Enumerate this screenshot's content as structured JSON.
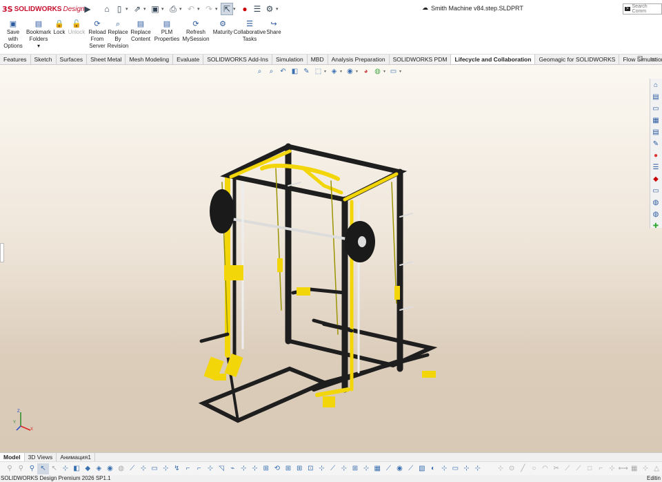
{
  "app": {
    "brand": "SOLIDWORKS",
    "brand_suffix": "Design",
    "logo_mark": "3S"
  },
  "document": {
    "title": "Smith Machine v84.step.SLDPRT"
  },
  "search": {
    "placeholder": "Search Comm"
  },
  "quick_access": [
    "home-icon",
    "new-icon",
    "open-icon",
    "save-icon",
    "print-icon",
    "undo-icon",
    "redo-icon",
    "select-icon",
    "traffic-light-icon",
    "file-properties-icon",
    "options-icon"
  ],
  "ribbon": {
    "buttons": [
      {
        "label": "Save with Options",
        "lines": [
          "Save",
          "with",
          "Options"
        ],
        "icon": "save-options-icon",
        "disabled": false
      },
      {
        "label": "Bookmark Folders",
        "lines": [
          "Bookmark",
          "Folders",
          "▾"
        ],
        "icon": "bookmark-icon",
        "disabled": false
      },
      {
        "label": "Lock",
        "lines": [
          "Lock"
        ],
        "icon": "lock-icon",
        "disabled": false
      },
      {
        "label": "Unlock",
        "lines": [
          "Unlock"
        ],
        "icon": "unlock-icon",
        "disabled": true
      },
      {
        "label": "Reload From Server",
        "lines": [
          "Reload",
          "From",
          "Server"
        ],
        "icon": "reload-icon",
        "disabled": false
      },
      {
        "label": "Replace By Revision",
        "lines": [
          "Replace",
          "By",
          "Revision"
        ],
        "icon": "replace-revision-icon",
        "disabled": false
      },
      {
        "label": "Replace Content",
        "lines": [
          "Replace",
          "Content"
        ],
        "icon": "replace-content-icon",
        "disabled": false
      },
      {
        "label": "PLM Properties",
        "lines": [
          "PLM",
          "Properties"
        ],
        "icon": "plm-icon",
        "disabled": false
      },
      {
        "label": "Refresh MySession",
        "lines": [
          "Refresh",
          "MySession"
        ],
        "icon": "refresh-icon",
        "disabled": false
      },
      {
        "label": "Maturity",
        "lines": [
          "Maturity"
        ],
        "icon": "maturity-icon",
        "disabled": false
      },
      {
        "label": "Collaborative Tasks",
        "lines": [
          "Collaborative",
          "Tasks"
        ],
        "icon": "tasks-icon",
        "disabled": false
      },
      {
        "label": "Share",
        "lines": [
          "Share"
        ],
        "icon": "share-icon",
        "disabled": false
      }
    ]
  },
  "tabs": [
    {
      "label": "Features",
      "active": false
    },
    {
      "label": "Sketch",
      "active": false
    },
    {
      "label": "Surfaces",
      "active": false
    },
    {
      "label": "Sheet Metal",
      "active": false
    },
    {
      "label": "Mesh Modeling",
      "active": false
    },
    {
      "label": "Evaluate",
      "active": false
    },
    {
      "label": "SOLIDWORKS Add-Ins",
      "active": false
    },
    {
      "label": "Simulation",
      "active": false
    },
    {
      "label": "MBD",
      "active": false
    },
    {
      "label": "Analysis Preparation",
      "active": false
    },
    {
      "label": "SOLIDWORKS PDM",
      "active": false
    },
    {
      "label": "Lifecycle and Collaboration",
      "active": true
    },
    {
      "label": "Geomagic for SOLIDWORKS",
      "active": false
    },
    {
      "label": "Flow Simulation",
      "active": false
    }
  ],
  "bottom_tabs": [
    {
      "label": "Model",
      "active": true
    },
    {
      "label": "3D Views",
      "active": false
    },
    {
      "label": "Анимация1",
      "active": false
    }
  ],
  "status": {
    "left": "SOLIDWORKS Design Premium 2026 SP1.1",
    "right": "Editin"
  },
  "triad": {
    "x": "X",
    "y": "Y",
    "z": "Z"
  },
  "colors": {
    "frame_yellow": "#f2d60a",
    "frame_black": "#1e1e1e",
    "brand_red": "#c8102e"
  }
}
